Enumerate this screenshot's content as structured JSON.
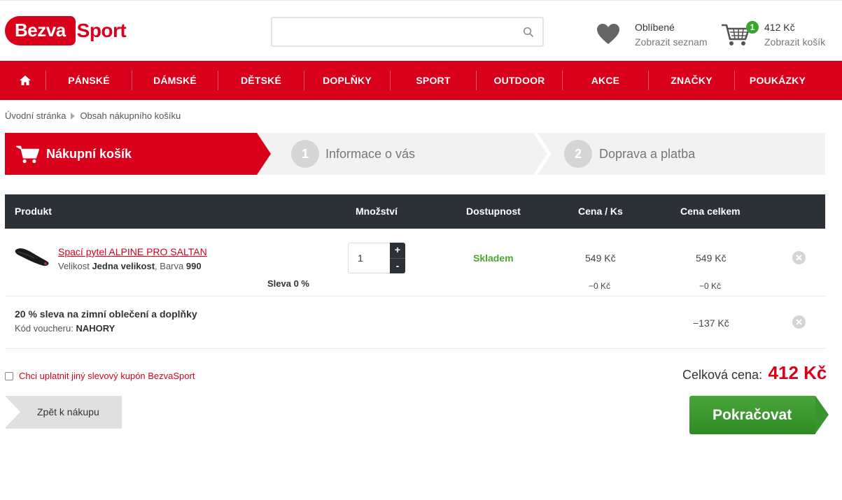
{
  "header": {
    "logo_part1": "Bezva",
    "logo_part2": "Sport",
    "search_placeholder": "",
    "favorites_title": "Oblíbené",
    "favorites_link": "Zobrazit seznam",
    "cart_count": "1",
    "cart_price": "412 Kč",
    "cart_link": "Zobrazit košík"
  },
  "nav": {
    "home_icon": "home-icon",
    "items": [
      "PÁNSKÉ",
      "DÁMSKÉ",
      "DĚTSKÉ",
      "DOPLŇKY",
      "SPORT",
      "OUTDOOR",
      "AKCE",
      "ZNAČKY",
      "POUKÁZKY"
    ]
  },
  "breadcrumb": [
    "Úvodní stránka",
    "Obsah nákupního košíku"
  ],
  "steps": [
    {
      "number": "",
      "label": "Nákupní košík",
      "active": true
    },
    {
      "number": "1",
      "label": "Informace o vás",
      "active": false
    },
    {
      "number": "2",
      "label": "Doprava a platba",
      "active": false
    }
  ],
  "table": {
    "headers": [
      "Produkt",
      "Množství",
      "Dostupnost",
      "Cena / Ks",
      "Cena celkem"
    ],
    "item": {
      "name": "Spací pytel ALPINE PRO SALTAN",
      "size_label": "Velikost",
      "size_value": "Jedna velikost",
      "color_label": "Barva",
      "color_value": "990",
      "discount_label": "Sleva 0 %",
      "quantity": "1",
      "qty_plus": "+",
      "qty_minus": "-",
      "availability": "Skladem",
      "unit_price": "549 Kč",
      "total_price": "549 Kč",
      "unit_discount": "−0 Kč",
      "total_discount": "−0 Kč"
    },
    "voucher": {
      "title": "20 % sleva na zimní oblečení a doplňky",
      "code_label": "Kód voucheru:",
      "code_value": "NAHORY",
      "amount": "−137 Kč"
    }
  },
  "coupon_label": "Chci uplatnit jiný slevový kupón BezvaSport",
  "total_label": "Celková cena:",
  "total_value": "412 Kč",
  "back_button": "Zpět k nákupu",
  "continue_button": "Pokračovat",
  "colors": {
    "brand_red": "#d9001c",
    "dark_header": "#2c3138",
    "green": "#4ca52e"
  }
}
